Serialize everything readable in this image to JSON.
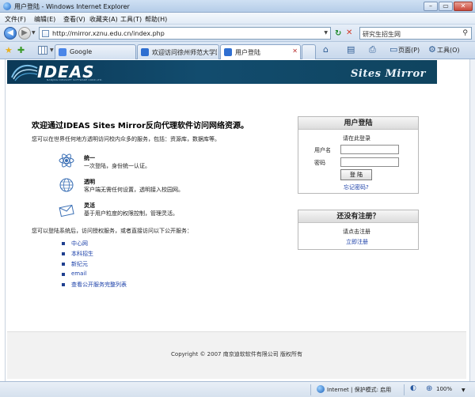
{
  "window": {
    "title": "用户登陆 - Windows Internet Explorer",
    "controls": {
      "minimize": "–",
      "maximize": "▭",
      "close": "✕"
    }
  },
  "menu": [
    "文件(F)",
    "编辑(E)",
    "查看(V)",
    "收藏夹(A)",
    "工具(T)",
    "帮助(H)"
  ],
  "address": {
    "url": "http://mirror.xznu.edu.cn/index.php",
    "search_placeholder": "研究生招生网"
  },
  "tabs": [
    {
      "label": "Google",
      "icon_color": "#4a86e8",
      "active": false
    },
    {
      "label": "欢迎访问徐州师范大学网...",
      "icon_color": "#2f6fd1",
      "active": false
    },
    {
      "label": "用户登陆",
      "icon_color": "#2f6fd1",
      "active": true
    }
  ],
  "toolbar_right": {
    "page_label": "页面(P)",
    "tools_label": "工具(O)"
  },
  "banner": {
    "logo": "IDEAS",
    "logo_sub": "NANJING IDEASOFT SOFTWARE CORP.,LTD.",
    "right_title": "Sites Mirror"
  },
  "main": {
    "heading": "欢迎通过IDEAS Sites Mirror反向代理软件访问网络资源。",
    "intro": "您可以在世界任何地方透明访问校内众多的服务，包括：资源库，数据库等。",
    "features": [
      {
        "icon": "atom-icon",
        "title": "统一",
        "desc": "一次登陆，身份统一认证。"
      },
      {
        "icon": "globe-icon",
        "title": "透明",
        "desc": "客户端无需任何设置，透明接入校园网。"
      },
      {
        "icon": "envelope-icon",
        "title": "灵活",
        "desc": "基于用户粒度的权限控制，管理灵活。"
      }
    ],
    "services_intro": "您可以登陆系统后，访问授权服务，或者直接访问以下公开服务：",
    "services": [
      "中心网",
      "本科招生",
      "新纪元",
      "email",
      "查看公开服务完整列表"
    ]
  },
  "login": {
    "title": "用户登陆",
    "prompt": "请在此登录",
    "username_label": "用户名",
    "password_label": "密码",
    "submit": "登 陆",
    "forgot": "忘记密码?"
  },
  "register": {
    "title": "还没有注册？",
    "prompt": "请点击注册",
    "link": "立即注册"
  },
  "footer": "Copyright © 2007 南京迪软软件有限公司 版权所有",
  "status": {
    "zone": "Internet | 保护模式: 启用",
    "zoom": "100%"
  }
}
